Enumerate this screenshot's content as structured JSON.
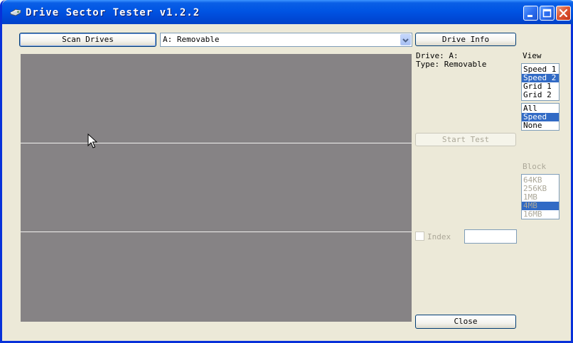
{
  "window": {
    "title": "Drive Sector Tester v1.2.2"
  },
  "toolbar": {
    "scan_label": "Scan Drives",
    "drive_select_value": "A: Removable",
    "drive_info_label": "Drive Info"
  },
  "info": {
    "drive_line": "Drive: A:",
    "type_line": "Type: Removable"
  },
  "view": {
    "heading": "View",
    "modes": [
      "Speed 1",
      "Speed 2",
      "Grid 1",
      "Grid 2"
    ],
    "selected_mode": "Speed 2",
    "filters": [
      "All",
      "Speed",
      "None"
    ],
    "selected_filter": "Speed"
  },
  "test": {
    "start_label": "Start Test"
  },
  "block": {
    "heading": "Block",
    "sizes": [
      "64KB",
      "256KB",
      "1MB",
      "4MB",
      "16MB"
    ],
    "selected_size": "4MB"
  },
  "index": {
    "label": "Index",
    "checked": false,
    "value": ""
  },
  "footer": {
    "close_label": "Close"
  },
  "colors": {
    "title_bar": "#0054e3",
    "canvas": "#868385",
    "selection": "#316ac5",
    "window_face": "#ece9d8"
  }
}
